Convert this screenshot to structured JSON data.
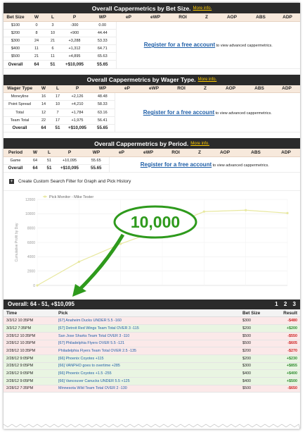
{
  "bet_size": {
    "title": "Overall Cappermetrics by Bet Size.",
    "more": "More info.",
    "headers": [
      "Bet Size",
      "W",
      "L",
      "P",
      "WP",
      "eP",
      "eWP",
      "ROI",
      "Z",
      "AOP",
      "ABS",
      "ADP"
    ],
    "rows": [
      [
        "$100",
        "0",
        "3",
        "-300",
        "0.00"
      ],
      [
        "$200",
        "8",
        "10",
        "+900",
        "44.44"
      ],
      [
        "$300",
        "24",
        "21",
        "+3,288",
        "53.33"
      ],
      [
        "$400",
        "11",
        "6",
        "+1,312",
        "64.71"
      ],
      [
        "$500",
        "21",
        "11",
        "+4,895",
        "65.63"
      ]
    ],
    "total": [
      "Overall",
      "64",
      "51",
      "+$10,095",
      "55.65"
    ]
  },
  "wager_type": {
    "title": "Overall Cappermetrics by Wager Type.",
    "more": "More info.",
    "headers": [
      "Wager Type",
      "W",
      "L",
      "P",
      "WP",
      "eP",
      "eWP",
      "ROI",
      "Z",
      "AOP",
      "ABS",
      "ADP"
    ],
    "rows": [
      [
        "Moneyline",
        "16",
        "17",
        "+2,126",
        "48.48"
      ],
      [
        "Point Spread",
        "14",
        "10",
        "+4,210",
        "58.33"
      ],
      [
        "Total",
        "12",
        "7",
        "+1,784",
        "63.16"
      ],
      [
        "Team Total",
        "22",
        "17",
        "+1,975",
        "56.41"
      ]
    ],
    "total": [
      "Overall",
      "64",
      "51",
      "+$10,095",
      "55.65"
    ]
  },
  "period": {
    "title": "Overall Cappermetrics by Period.",
    "more": "More info.",
    "headers": [
      "Period",
      "W",
      "L",
      "P",
      "WP",
      "eP",
      "eWP",
      "ROI",
      "Z",
      "AOP",
      "ABS",
      "ADP"
    ],
    "rows": [
      [
        "Game",
        "64",
        "51",
        "+10,095",
        "55.65"
      ]
    ],
    "total": [
      "Overall",
      "64",
      "51",
      "+$10,095",
      "55.65"
    ]
  },
  "promo": {
    "link": "Register for a free account",
    "rest": "to view advanced cappermetrics."
  },
  "filter": {
    "icon": "plus-icon",
    "label": "Create Custom Search Filter for Graph and Pick History"
  },
  "chart_data": {
    "type": "line",
    "title": "",
    "xlabel": "",
    "ylabel": "Cumulative Profit by Day",
    "series": [
      {
        "name": "Pick Monitor - Mike Tester",
        "values": [
          0,
          3300,
          5800,
          7900,
          10300,
          10500,
          10095
        ]
      }
    ],
    "x": [
      1,
      2,
      3,
      4,
      5,
      6,
      7
    ],
    "y_ticks": [
      "0",
      "2000",
      "4000",
      "6000",
      "8000",
      "10000",
      "12000"
    ],
    "ylim": [
      0,
      12000
    ],
    "grid": true,
    "line_color": "#e8e8a0"
  },
  "annotation": {
    "text": "10,000",
    "color": "#2e9a1c"
  },
  "overall_bar": {
    "text": "Overall: 64 - 51, +$10,095",
    "pages": [
      "1",
      "2",
      "3"
    ]
  },
  "picks": {
    "headers": [
      "Time",
      "Pick",
      "Bet Size",
      "Result"
    ],
    "rows": [
      [
        "3/3/12 10:35PM",
        "[67] Anaheim Ducks UNDER 5.5 -160",
        "$300",
        "-$480",
        "loss"
      ],
      [
        "3/3/12 7:35PM",
        "[67] Detroit Red Wings Team Total OVER 3 -115",
        "$200",
        "+$200",
        "win"
      ],
      [
        "2/28/12 10:35PM",
        "San Jose Sharks Team Total OVER 3 -110",
        "$500",
        "-$550",
        "loss"
      ],
      [
        "2/28/12 10:35PM",
        "[67] Philadelphia Flyers OVER 5.5 -121",
        "$500",
        "-$605",
        "loss"
      ],
      [
        "2/28/12 10:35PM",
        "Philadelphia Flyers Team Total OVER 2.5 -135",
        "$200",
        "-$270",
        "loss"
      ],
      [
        "2/28/12 9:05PM",
        "[66] Phoenix Coyotes +115",
        "$200",
        "+$230",
        "win"
      ],
      [
        "2/28/12 9:05PM",
        "[66] VANPHO goes to overtime +285",
        "$300",
        "+$855",
        "win"
      ],
      [
        "2/28/12 9:05PM",
        "[66] Phoenix Coyotes +1.5 -255",
        "$400",
        "+$400",
        "win"
      ],
      [
        "2/28/12 9:05PM",
        "[66] Vancouver Canucks UNDER 5.5 +125",
        "$400",
        "+$500",
        "win"
      ],
      [
        "2/28/12 7:35PM",
        "Minnesota Wild Team Total OVER 2 -130",
        "$500",
        "-$650",
        "loss"
      ]
    ]
  }
}
